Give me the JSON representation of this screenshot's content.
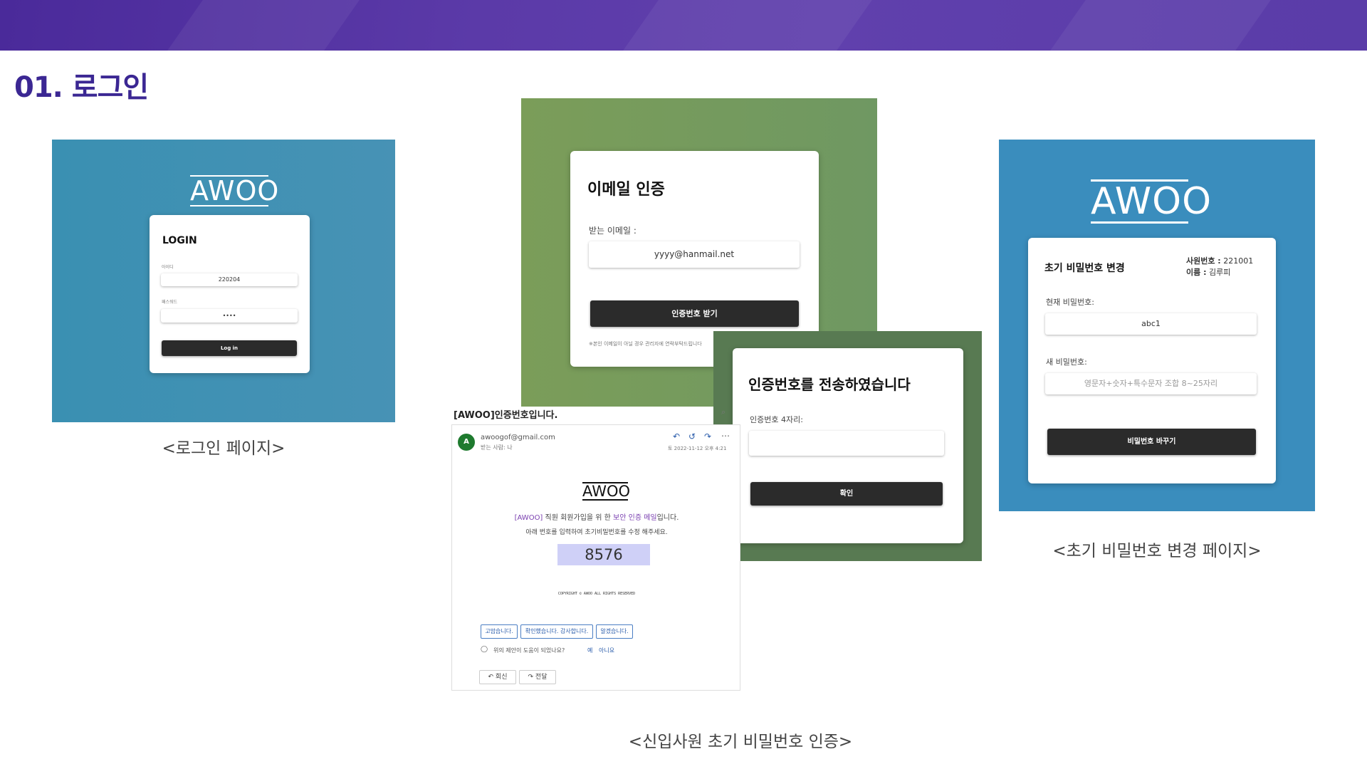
{
  "section_title": "01. 로그인",
  "login_page": {
    "logo": "AWOO",
    "title": "LOGIN",
    "id_label": "아이디",
    "id_value": "220204",
    "pw_label": "패스워드",
    "pw_value": "••••",
    "button": "Log in",
    "caption": "<로그인 페이지>"
  },
  "email_verify": {
    "title": "이메일 인증",
    "recipient_label": "받는 이메일 :",
    "recipient_value": "yyyy@hanmail.net",
    "button": "인증번호 받기",
    "note": "※본인 이메일이 아닐 경우 관리자에 연락부탁드립니다"
  },
  "code_sent": {
    "title": "인증번호를 전송하였습니다",
    "code_label": "인증번호 4자리:",
    "code_value": "",
    "button": "확인"
  },
  "email_message": {
    "subject": "[AWOO]인증번호입니다.",
    "sender_initial": "A",
    "sender": "awoogof@gmail.com",
    "to": "받는 사람: 나",
    "date": "토 2022-11-12 오후 4:21",
    "logo": "AWOO",
    "line1_pre": "[AWOO]",
    "line1_mid": " 직원 회원가입을 위 한 ",
    "line1_link": "보안 인증 메일",
    "line1_post": "입니다.",
    "line2": "아래 번호를 입력하여 초기비밀번호를 수정 해주세요.",
    "code": "8576",
    "copyright": "COPYRIGHT © AWOO ALL RIGHTS RESERVED",
    "quick_replies": [
      "고맙습니다.",
      "확인했습니다. 감사합니다.",
      "알겠습니다."
    ],
    "feedback_question": "위의 제안이 도움이 되었나요?",
    "feedback_yes": "예",
    "feedback_no": "아니요",
    "reply": "회신",
    "forward": "전달"
  },
  "email_caption": "<신입사원 초기 비밀번호 인증>",
  "password_change": {
    "logo": "AWOO",
    "title": "초기 비밀번호 변경",
    "emp_no_label": "사원번호 :",
    "emp_no_value": "221001",
    "name_label": "이름 :",
    "name_value": "김루피",
    "current_label": "현재 비밀번호:",
    "current_value": "abc1",
    "new_label": "새 비밀번호:",
    "new_placeholder": "영문자+숫자+특수문자 조합 8~25자리",
    "button": "비밀번호 바꾸기",
    "caption": "<초기 비밀번호 변경 페이지>"
  },
  "colors": {
    "banner": "#5b3aa8",
    "title": "#3b2793",
    "login_bg": "#3f8fb3",
    "green_bg": "#739a5e",
    "dark_green_bg": "#587a52",
    "blue_bg": "#3a8dbd",
    "button": "#2b2b2b",
    "code_highlight": "#cfd0f7"
  }
}
